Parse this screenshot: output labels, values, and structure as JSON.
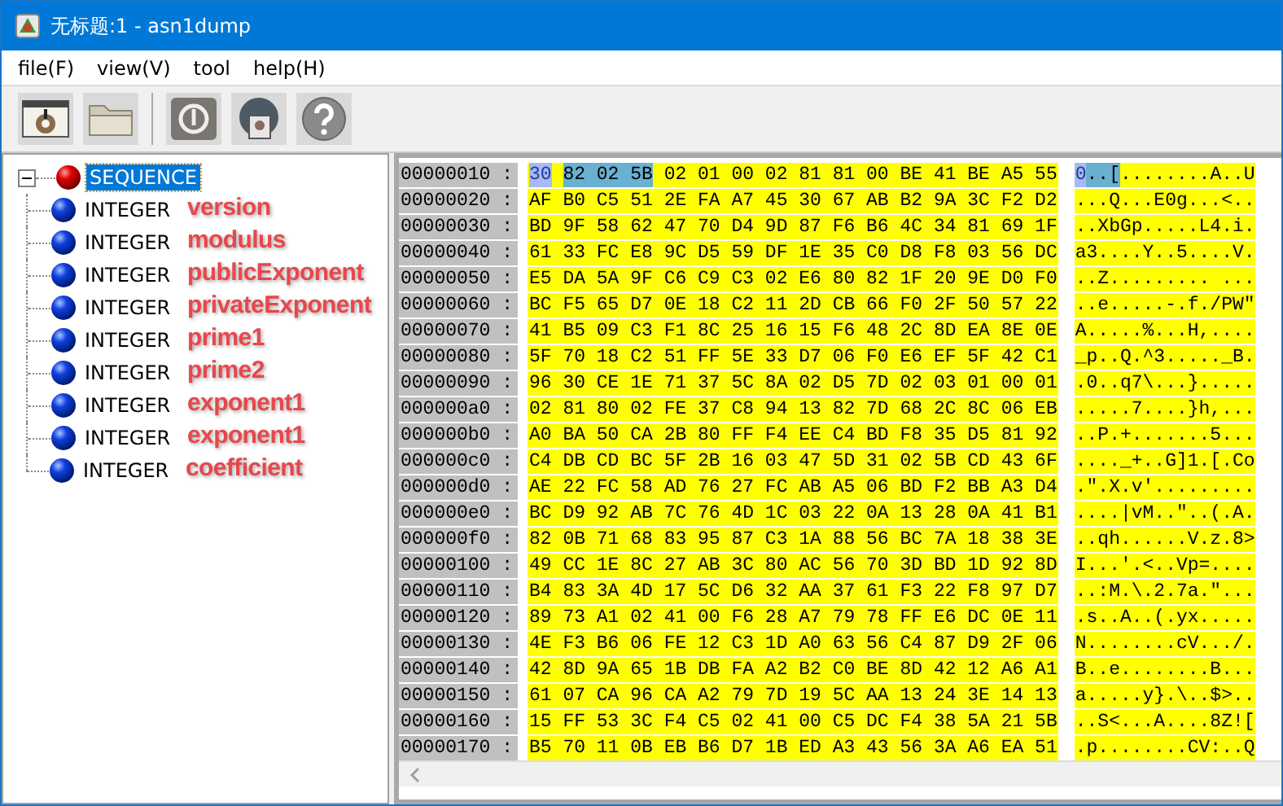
{
  "window": {
    "title": "无标题:1 - asn1dump"
  },
  "menu": [
    "file(F)",
    "view(V)",
    "tool",
    "help(H)"
  ],
  "toolbar": [
    {
      "kind": "settings"
    },
    {
      "kind": "folder"
    },
    {
      "kind": "power"
    },
    {
      "kind": "globe"
    },
    {
      "kind": "help"
    }
  ],
  "tree": {
    "label": "SEQUENCE",
    "selected": true,
    "expanded": true,
    "children": [
      {
        "label": "INTEGER",
        "annotation": "version"
      },
      {
        "label": "INTEGER",
        "annotation": "modulus"
      },
      {
        "label": "INTEGER",
        "annotation": "publicExponent"
      },
      {
        "label": "INTEGER",
        "annotation": "privateExponent"
      },
      {
        "label": "INTEGER",
        "annotation": "prime1"
      },
      {
        "label": "INTEGER",
        "annotation": "prime2"
      },
      {
        "label": "INTEGER",
        "annotation": "exponent1"
      },
      {
        "label": "INTEGER",
        "annotation": "exponent1"
      },
      {
        "label": "INTEGER",
        "annotation": "coefficient"
      }
    ]
  },
  "hex_rows": [
    {
      "address": "00000010 :",
      "hex": [
        {
          "text": "30",
          "selected": true,
          "highlighted": false
        },
        {
          "text": "82 02 5B",
          "selected": false,
          "highlighted": true
        },
        {
          "text": "02 01 00 02 81 81 00 BE 41 BE A5 55",
          "selected": false,
          "highlighted": false
        }
      ],
      "ascii": [
        {
          "text": "0",
          "selected": true,
          "highlighted": false
        },
        {
          "text": "..[",
          "selected": false,
          "highlighted": true
        },
        {
          "text": "........A..U",
          "selected": false,
          "highlighted": false
        }
      ]
    },
    {
      "address": "00000020 :",
      "hex": [
        {
          "text": "AF B0 C5 51 2E FA A7 45 30 67 AB B2 9A 3C F2 D2",
          "selected": false,
          "highlighted": false
        }
      ],
      "ascii": [
        {
          "text": "...Q...E0g...<..",
          "selected": false,
          "highlighted": false
        }
      ]
    },
    {
      "address": "00000030 :",
      "hex": [
        {
          "text": "BD 9F 58 62 47 70 D4 9D 87 F6 B6 4C 34 81 69 1F",
          "selected": false,
          "highlighted": false
        }
      ],
      "ascii": [
        {
          "text": "..XbGp.....L4.i.",
          "selected": false,
          "highlighted": false
        }
      ]
    },
    {
      "address": "00000040 :",
      "hex": [
        {
          "text": "61 33 FC E8 9C D5 59 DF 1E 35 C0 D8 F8 03 56 DC",
          "selected": false,
          "highlighted": false
        }
      ],
      "ascii": [
        {
          "text": "a3....Y..5....V.",
          "selected": false,
          "highlighted": false
        }
      ]
    },
    {
      "address": "00000050 :",
      "hex": [
        {
          "text": "E5 DA 5A 9F C6 C9 C3 02 E6 80 82 1F 20 9E D0 F0",
          "selected": false,
          "highlighted": false
        }
      ],
      "ascii": [
        {
          "text": "..Z......... ...",
          "selected": false,
          "highlighted": false
        }
      ]
    },
    {
      "address": "00000060 :",
      "hex": [
        {
          "text": "BC F5 65 D7 0E 18 C2 11 2D CB 66 F0 2F 50 57 22",
          "selected": false,
          "highlighted": false
        }
      ],
      "ascii": [
        {
          "text": "..e.....-.f./PW\"",
          "selected": false,
          "highlighted": false
        }
      ]
    },
    {
      "address": "00000070 :",
      "hex": [
        {
          "text": "41 B5 09 C3 F1 8C 25 16 15 F6 48 2C 8D EA 8E 0E",
          "selected": false,
          "highlighted": false
        }
      ],
      "ascii": [
        {
          "text": "A.....%...H,....",
          "selected": false,
          "highlighted": false
        }
      ]
    },
    {
      "address": "00000080 :",
      "hex": [
        {
          "text": "5F 70 18 C2 51 FF 5E 33 D7 06 F0 E6 EF 5F 42 C1",
          "selected": false,
          "highlighted": false
        }
      ],
      "ascii": [
        {
          "text": "_p..Q.^3....._B.",
          "selected": false,
          "highlighted": false
        }
      ]
    },
    {
      "address": "00000090 :",
      "hex": [
        {
          "text": "96 30 CE 1E 71 37 5C 8A 02 D5 7D 02 03 01 00 01",
          "selected": false,
          "highlighted": false
        }
      ],
      "ascii": [
        {
          "text": ".0..q7\\...}.....",
          "selected": false,
          "highlighted": false
        }
      ]
    },
    {
      "address": "000000a0 :",
      "hex": [
        {
          "text": "02 81 80 02 FE 37 C8 94 13 82 7D 68 2C 8C 06 EB",
          "selected": false,
          "highlighted": false
        }
      ],
      "ascii": [
        {
          "text": ".....7....}h,...",
          "selected": false,
          "highlighted": false
        }
      ]
    },
    {
      "address": "000000b0 :",
      "hex": [
        {
          "text": "A0 BA 50 CA 2B 80 FF F4 EE C4 BD F8 35 D5 81 92",
          "selected": false,
          "highlighted": false
        }
      ],
      "ascii": [
        {
          "text": "..P.+.......5...",
          "selected": false,
          "highlighted": false
        }
      ]
    },
    {
      "address": "000000c0 :",
      "hex": [
        {
          "text": "C4 DB CD BC 5F 2B 16 03 47 5D 31 02 5B CD 43 6F",
          "selected": false,
          "highlighted": false
        }
      ],
      "ascii": [
        {
          "text": "...._+..G]1.[.Co",
          "selected": false,
          "highlighted": false
        }
      ]
    },
    {
      "address": "000000d0 :",
      "hex": [
        {
          "text": "AE 22 FC 58 AD 76 27 FC AB A5 06 BD F2 BB A3 D4",
          "selected": false,
          "highlighted": false
        }
      ],
      "ascii": [
        {
          "text": ".\".X.v'.........",
          "selected": false,
          "highlighted": false
        }
      ]
    },
    {
      "address": "000000e0 :",
      "hex": [
        {
          "text": "BC D9 92 AB 7C 76 4D 1C 03 22 0A 13 28 0A 41 B1",
          "selected": false,
          "highlighted": false
        }
      ],
      "ascii": [
        {
          "text": "....|vM..\"..(.A.",
          "selected": false,
          "highlighted": false
        }
      ]
    },
    {
      "address": "000000f0 :",
      "hex": [
        {
          "text": "82 0B 71 68 83 95 87 C3 1A 88 56 BC 7A 18 38 3E",
          "selected": false,
          "highlighted": false
        }
      ],
      "ascii": [
        {
          "text": "..qh......V.z.8>",
          "selected": false,
          "highlighted": false
        }
      ]
    },
    {
      "address": "00000100 :",
      "hex": [
        {
          "text": "49 CC 1E 8C 27 AB 3C 80 AC 56 70 3D BD 1D 92 8D",
          "selected": false,
          "highlighted": false
        }
      ],
      "ascii": [
        {
          "text": "I...'.<..Vp=....",
          "selected": false,
          "highlighted": false
        }
      ]
    },
    {
      "address": "00000110 :",
      "hex": [
        {
          "text": "B4 83 3A 4D 17 5C D6 32 AA 37 61 F3 22 F8 97 D7",
          "selected": false,
          "highlighted": false
        }
      ],
      "ascii": [
        {
          "text": "..:M.\\.2.7a.\"...",
          "selected": false,
          "highlighted": false
        }
      ]
    },
    {
      "address": "00000120 :",
      "hex": [
        {
          "text": "89 73 A1 02 41 00 F6 28 A7 79 78 FF E6 DC 0E 11",
          "selected": false,
          "highlighted": false
        }
      ],
      "ascii": [
        {
          "text": ".s..A..(.yx.....",
          "selected": false,
          "highlighted": false
        }
      ]
    },
    {
      "address": "00000130 :",
      "hex": [
        {
          "text": "4E F3 B6 06 FE 12 C3 1D A0 63 56 C4 87 D9 2F 06",
          "selected": false,
          "highlighted": false
        }
      ],
      "ascii": [
        {
          "text": "N........cV.../.",
          "selected": false,
          "highlighted": false
        }
      ]
    },
    {
      "address": "00000140 :",
      "hex": [
        {
          "text": "42 8D 9A 65 1B DB FA A2 B2 C0 BE 8D 42 12 A6 A1",
          "selected": false,
          "highlighted": false
        }
      ],
      "ascii": [
        {
          "text": "B..e........B...",
          "selected": false,
          "highlighted": false
        }
      ]
    },
    {
      "address": "00000150 :",
      "hex": [
        {
          "text": "61 07 CA 96 CA A2 79 7D 19 5C AA 13 24 3E 14 13",
          "selected": false,
          "highlighted": false
        }
      ],
      "ascii": [
        {
          "text": "a.....y}.\\..$>..",
          "selected": false,
          "highlighted": false
        }
      ]
    },
    {
      "address": "00000160 :",
      "hex": [
        {
          "text": "15 FF 53 3C F4 C5 02 41 00 C5 DC F4 38 5A 21 5B",
          "selected": false,
          "highlighted": false
        }
      ],
      "ascii": [
        {
          "text": "..S<...A....8Z![",
          "selected": false,
          "highlighted": false
        }
      ]
    },
    {
      "address": "00000170 :",
      "hex": [
        {
          "text": "B5 70 11 0B EB B6 D7 1B ED A3 43 56 3A A6 EA 51",
          "selected": false,
          "highlighted": false
        }
      ],
      "ascii": [
        {
          "text": ".p........CV:..Q",
          "selected": false,
          "highlighted": false
        }
      ]
    }
  ]
}
